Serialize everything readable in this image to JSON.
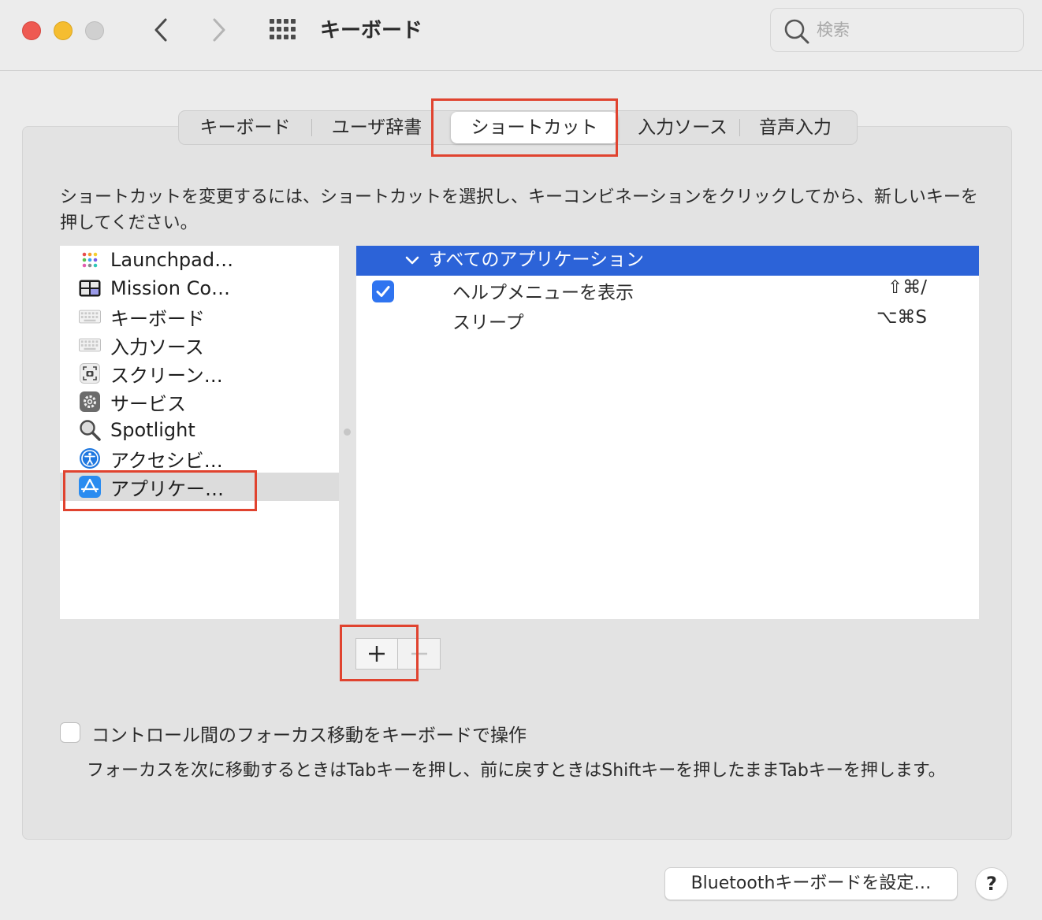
{
  "window": {
    "title": "キーボード",
    "search_placeholder": "検索"
  },
  "tabs": [
    {
      "label": "キーボード",
      "active": false
    },
    {
      "label": "ユーザ辞書",
      "active": false
    },
    {
      "label": "ショートカット",
      "active": true
    },
    {
      "label": "入力ソース",
      "active": false
    },
    {
      "label": "音声入力",
      "active": false
    }
  ],
  "instructions": "ショートカットを変更するには、ショートカットを選択し、キーコンビネーションをクリックしてから、新しいキーを押してください。",
  "categories": [
    {
      "label": "Launchpad…",
      "icon": "launchpad-icon"
    },
    {
      "label": "Mission Co…",
      "icon": "mission-control-icon"
    },
    {
      "label": "キーボード",
      "icon": "keyboard-icon"
    },
    {
      "label": "入力ソース",
      "icon": "keyboard-icon"
    },
    {
      "label": "スクリーン…",
      "icon": "screenshot-icon"
    },
    {
      "label": "サービス",
      "icon": "gear-icon"
    },
    {
      "label": "Spotlight",
      "icon": "magnifier-icon"
    },
    {
      "label": "アクセシビ…",
      "icon": "accessibility-icon"
    },
    {
      "label": "アプリケー…",
      "icon": "app-store-icon",
      "selected": true
    }
  ],
  "shortcuts": {
    "group_label": "すべてのアプリケーション",
    "items": [
      {
        "label": "ヘルプメニューを表示",
        "keys": "⇧⌘/",
        "checked": true
      },
      {
        "label": "スリープ",
        "keys": "⌥⌘S",
        "checked": null
      }
    ]
  },
  "buttons": {
    "add": "+",
    "remove": "−"
  },
  "focus_option": {
    "label": "コントロール間のフォーカス移動をキーボードで操作",
    "checked": false,
    "description": "フォーカスを次に移動するときはTabキーを押し、前に戻すときはShiftキーを押したままTabキーを押します。"
  },
  "footer": {
    "bluetooth_button": "Bluetoothキーボードを設定…",
    "help_button": "?"
  },
  "colors": {
    "selection_blue": "#2c63d8",
    "highlight_red": "#e0432f",
    "checkbox_blue": "#2f74f0"
  }
}
